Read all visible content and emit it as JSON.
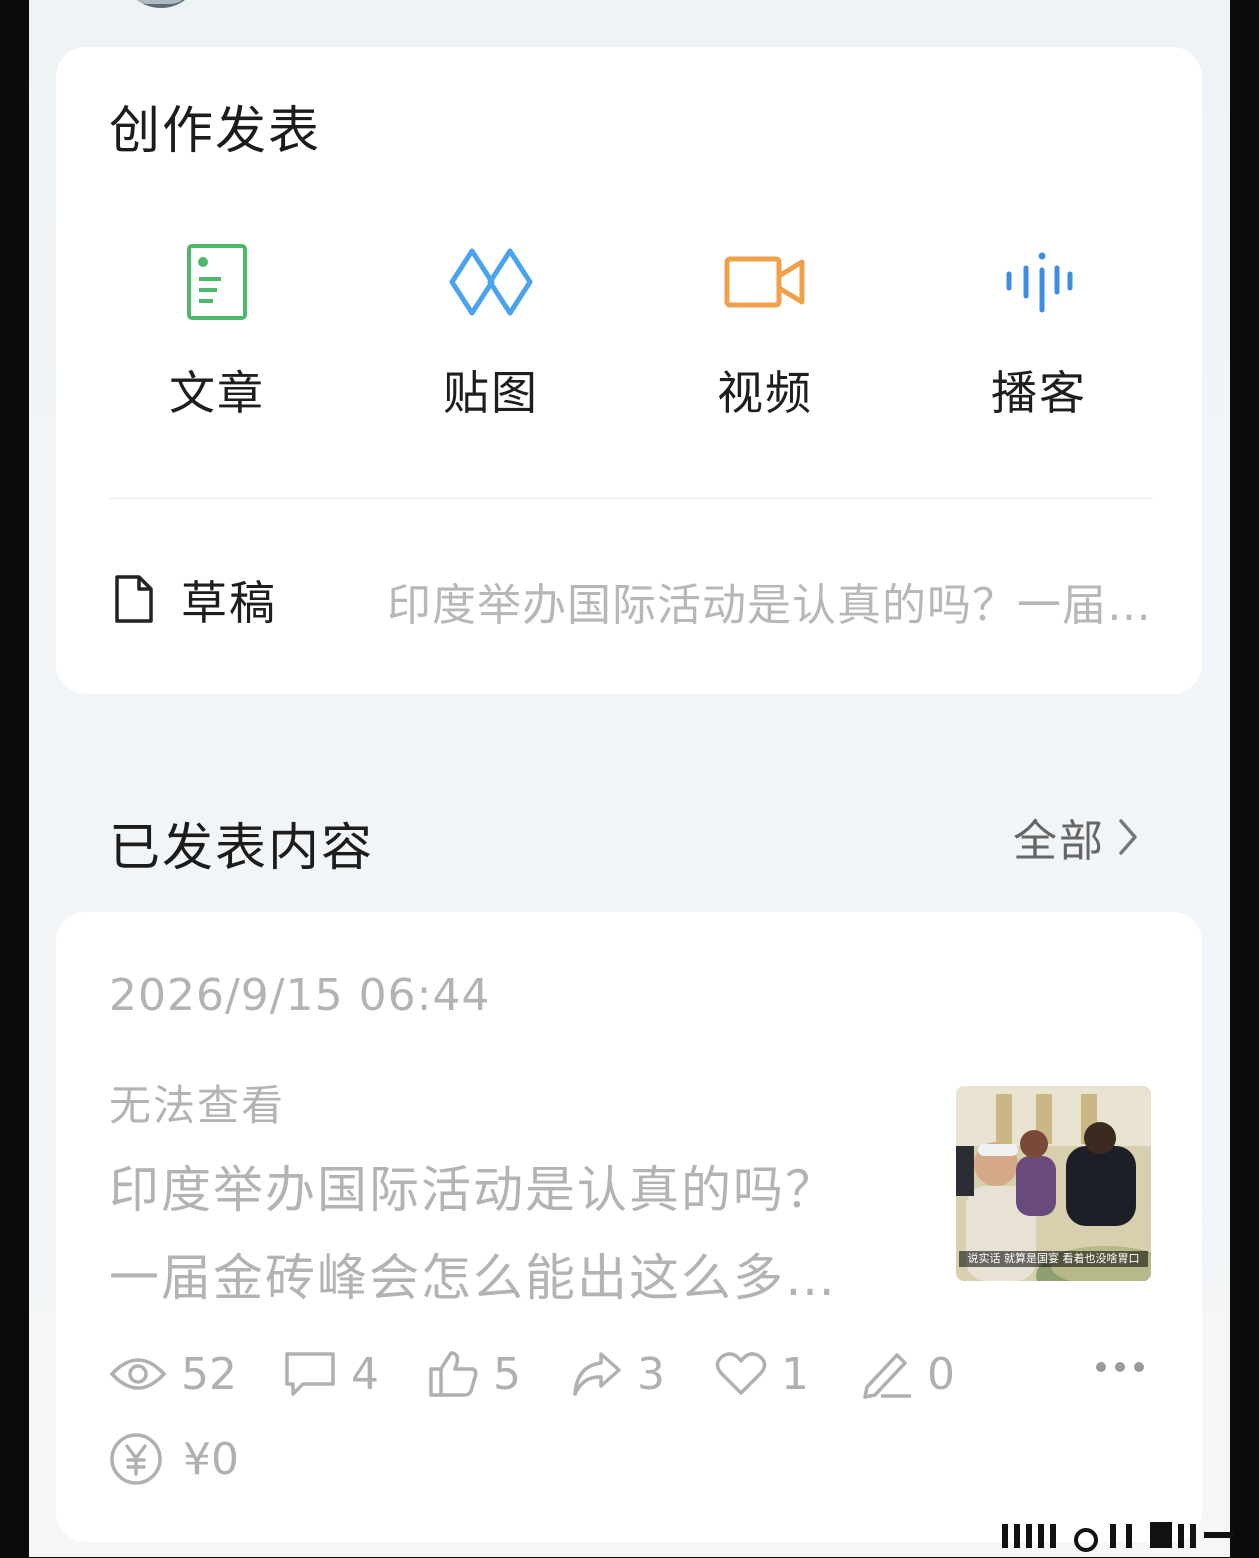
{
  "create": {
    "title": "创作发表",
    "tools": [
      {
        "label": "文章",
        "icon": "article-icon",
        "color": "#4cb86a"
      },
      {
        "label": "贴图",
        "icon": "image-post-icon",
        "color": "#4aa3ee"
      },
      {
        "label": "视频",
        "icon": "video-camera-icon",
        "color": "#f0a04b"
      },
      {
        "label": "播客",
        "icon": "podcast-icon",
        "color": "#3d8de6"
      }
    ],
    "draft": {
      "label": "草稿",
      "preview": "印度举办国际活动是认真的吗？一届金砖峰会怎么能出这么多…"
    }
  },
  "published": {
    "title": "已发表内容",
    "all_label": "全部",
    "post": {
      "date": "2026/9/15 06:44",
      "status": "无法查看",
      "title": "印度举办国际活动是认真的吗？一届金砖峰会怎么能出这么多…",
      "thumb_caption": "说实话 就算是国宴 看着也没啥胃口",
      "stats": {
        "views": "52",
        "comments": "4",
        "likes": "5",
        "shares": "3",
        "favorites": "1",
        "edits": "0"
      },
      "income": "¥0"
    }
  },
  "colors": {
    "stat_gray": "#b0b0b0",
    "text_dark": "#1c1c1c",
    "muted": "#b3b3b3"
  }
}
